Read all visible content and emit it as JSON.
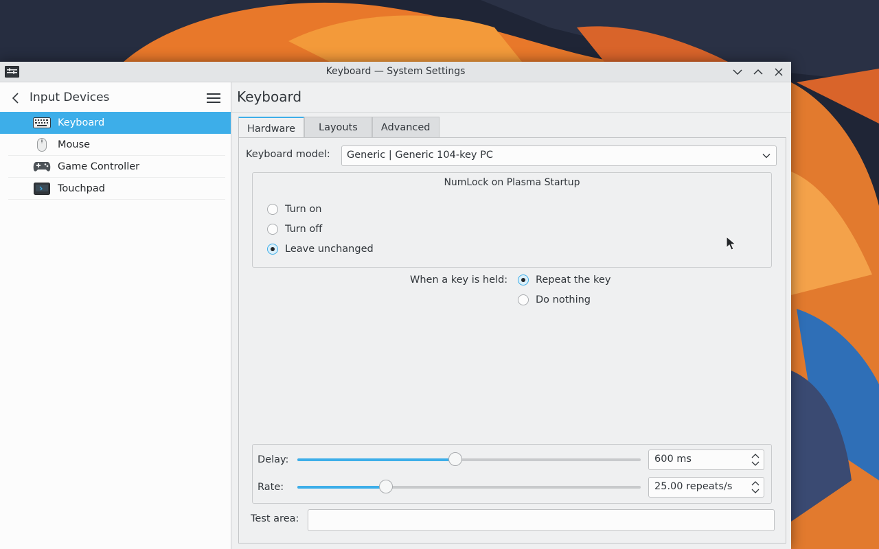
{
  "window": {
    "title": "Keyboard — System Settings"
  },
  "sidebar": {
    "title": "Input Devices",
    "items": [
      {
        "label": "Keyboard",
        "icon": "keyboard-icon",
        "active": true
      },
      {
        "label": "Mouse",
        "icon": "mouse-icon",
        "active": false
      },
      {
        "label": "Game Controller",
        "icon": "gamepad-icon",
        "active": false
      },
      {
        "label": "Touchpad",
        "icon": "touchpad-icon",
        "active": false
      }
    ]
  },
  "main": {
    "title": "Keyboard",
    "tabs": [
      {
        "label": "Hardware",
        "active": true
      },
      {
        "label": "Layouts",
        "active": false
      },
      {
        "label": "Advanced",
        "active": false
      }
    ],
    "keyboard_model": {
      "label": "Keyboard model:",
      "value": "Generic | Generic 104-key PC"
    },
    "numlock": {
      "title": "NumLock on Plasma Startup",
      "options": [
        {
          "label": "Turn on",
          "checked": false
        },
        {
          "label": "Turn off",
          "checked": false
        },
        {
          "label": "Leave unchanged",
          "checked": true
        }
      ]
    },
    "key_held": {
      "label": "When a key is held:",
      "options": [
        {
          "label": "Repeat the key",
          "checked": true
        },
        {
          "label": "Do nothing",
          "checked": false
        }
      ]
    },
    "delay": {
      "label": "Delay:",
      "value": "600 ms",
      "fraction": 0.46
    },
    "rate": {
      "label": "Rate:",
      "value": "25.00 repeats/s",
      "fraction": 0.258
    },
    "test_area": {
      "label": "Test area:",
      "value": ""
    }
  },
  "colors": {
    "accent": "#3daee9",
    "window_bg": "#eff0f1",
    "sidebar_bg": "#fcfcfc"
  }
}
